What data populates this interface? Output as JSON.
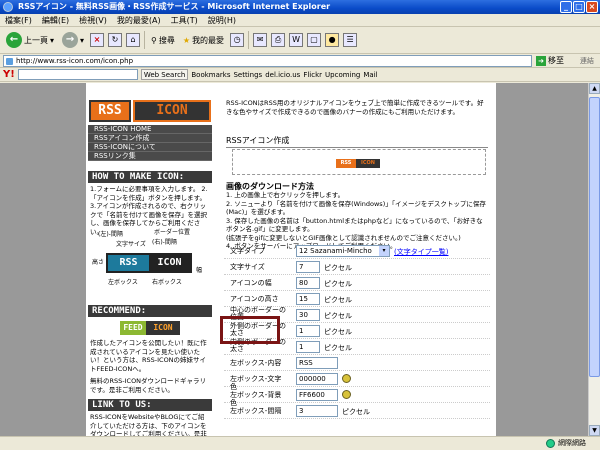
{
  "window": {
    "title": "RSSアイコン - 無料RSS画像・RSS作成サービス - Microsoft Internet Explorer",
    "controls": [
      "_",
      "□",
      "×"
    ]
  },
  "menu": [
    "檔案(F)",
    "編輯(E)",
    "檢視(V)",
    "我的最愛(A)",
    "工具(T)",
    "說明(H)"
  ],
  "toolbar": {
    "back_label": "上一頁",
    "search_label": "搜尋",
    "favorites_label": "我的最愛"
  },
  "address": {
    "url": "http://www.rss-icon.com/icon.php",
    "go_label": "移至",
    "links_label": "連結"
  },
  "yahoo": {
    "web_search": "Web Search",
    "bookmarks": "Bookmarks",
    "settings": "Settings",
    "delicious": "del.icio.us",
    "flickr": "Flickr",
    "upcoming": "Upcoming",
    "mail": "Mail"
  },
  "status": {
    "zone": "網際網路"
  },
  "sidebar": {
    "logo_left": "RSS",
    "logo_right": "ICON",
    "nav": [
      "RSS-ICON HOME",
      "RSSアイコン作成",
      "RSS-ICONについて",
      "RSSリンク集"
    ],
    "howto_title": "HOW TO MAKE ICON:",
    "howto_text": "1.フォームに必要事項を入力します。 2.「アイコンを作成」ボタンを押します。 3.アイコンが作成されるので、右クリックで「名前を付けて画像を保存」を選択し、画像を保存してからご利用ください。",
    "diagram": {
      "border_pos": "ボーダー位置",
      "right_gap": "(右)-間隔",
      "left_gap": "(左)-間隔",
      "font_size": "文字サイズ",
      "height": "高さ",
      "width": "幅",
      "left_box": "左ボックス",
      "right_box": "右ボックス",
      "icon_left": "RSS",
      "icon_right": "ICON"
    },
    "recommend_title": "RECOMMEND:",
    "feed_left": "FEED",
    "feed_right": "ICON",
    "recommend_text": "作成したアイコンを公開したい！既に作成されているアイコンを見たい使いたい！という方は、RSS-ICONの姉妹サイトFEED-ICONへ。",
    "gallery_text": "無料のRSS-ICONダウンロードギャラリです。是非ご利用ください。",
    "link_title": "LINK TO US:",
    "link_text": "RSS-ICONをWebsiteやBLOGにてご紹介していただける方は、下のアイコンをダウンロードしてご利用ください。是非よろしく"
  },
  "main": {
    "intro": "RSS-ICONはRSS用のオリジナルアイコンをウェブ上で簡単に作成できるツールです。好きな色やサイズで作成できるので画像のバナーの作成にもご利用いただけます。",
    "section_title": "RSSアイコン作成",
    "preview_left": "RSS",
    "preview_right": "ICON",
    "download_title": "画像のダウンロード方法",
    "steps": [
      "1. 上の画像上で右クリックを押します。",
      "2. ソニューより「名前を付けて画像を保存(Windows)」「イメージをデスクトップに保存(Mac)」を選びます。",
      "3. 保存した画像の名前は「button.htmlまたはphpなど」になっているので、「お好きなボタン名.gif」に変更します。",
      "(拡張子をgifに変更しないとGIF画像として認識されませんのでご注意ください。)",
      "4. ボタンをサーバーにアップロードしてご利用ください。"
    ],
    "form": {
      "font_type_label": "文字タイプ",
      "font_type_value": "12 Sazanami-Mincho",
      "font_type_link": "(文字タイプ一覧)",
      "font_size_label": "文字サイズ",
      "font_size_value": "7",
      "width_label": "アイコンの幅",
      "width_value": "80",
      "height_label": "アイコンの高さ",
      "height_value": "15",
      "center_border_label": "中心のボーダーの位置",
      "center_border_value": "30",
      "outer_border_label": "外側のボーダーの太さ",
      "outer_border_value": "1",
      "inner_border_label": "内側のボーダーの太さ",
      "inner_border_value": "1",
      "left_text_label": "左ボックス-内容",
      "left_text_value": "RSS",
      "left_fg_label": "左ボックス-文字色",
      "left_fg_value": "000000",
      "left_bg_label": "左ボックス-背景色",
      "left_bg_value": "FF6600",
      "left_gap_label": "左ボックス-間隔",
      "left_gap_value": "3",
      "unit": "ピクセル"
    }
  },
  "colors": {
    "orange": "#e8701a",
    "dark": "#333333",
    "highlight": "#7a1414"
  }
}
